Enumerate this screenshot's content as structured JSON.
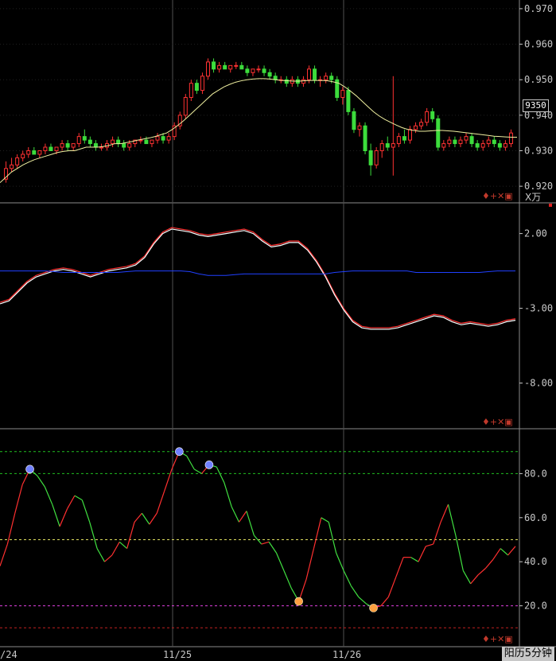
{
  "chart_data": [
    {
      "type": "candlestick",
      "panel": "price",
      "y_ticks": [
        "0.970",
        "0.960",
        "0.950",
        "0.940",
        "0.930",
        "0.920"
      ],
      "ylim": [
        0.916,
        0.972
      ],
      "current_price_label": "9350",
      "candles_ohlc": [
        [
          0.922,
          0.927,
          0.921,
          0.925
        ],
        [
          0.925,
          0.928,
          0.924,
          0.926
        ],
        [
          0.926,
          0.929,
          0.925,
          0.928
        ],
        [
          0.928,
          0.93,
          0.927,
          0.929
        ],
        [
          0.929,
          0.931,
          0.928,
          0.93
        ],
        [
          0.93,
          0.931,
          0.929,
          0.929
        ],
        [
          0.929,
          0.93,
          0.928,
          0.93
        ],
        [
          0.93,
          0.932,
          0.929,
          0.931
        ],
        [
          0.931,
          0.932,
          0.93,
          0.93
        ],
        [
          0.93,
          0.931,
          0.929,
          0.931
        ],
        [
          0.931,
          0.933,
          0.93,
          0.932
        ],
        [
          0.932,
          0.933,
          0.93,
          0.931
        ],
        [
          0.931,
          0.932,
          0.93,
          0.932
        ],
        [
          0.932,
          0.935,
          0.931,
          0.934
        ],
        [
          0.934,
          0.936,
          0.932,
          0.933
        ],
        [
          0.933,
          0.934,
          0.931,
          0.932
        ],
        [
          0.932,
          0.933,
          0.93,
          0.931
        ],
        [
          0.931,
          0.932,
          0.93,
          0.931
        ],
        [
          0.931,
          0.933,
          0.93,
          0.932
        ],
        [
          0.932,
          0.934,
          0.931,
          0.933
        ],
        [
          0.933,
          0.934,
          0.931,
          0.932
        ],
        [
          0.932,
          0.933,
          0.93,
          0.931
        ],
        [
          0.931,
          0.933,
          0.93,
          0.932
        ],
        [
          0.932,
          0.933,
          0.931,
          0.933
        ],
        [
          0.933,
          0.934,
          0.932,
          0.933
        ],
        [
          0.933,
          0.934,
          0.932,
          0.932
        ],
        [
          0.932,
          0.933,
          0.931,
          0.933
        ],
        [
          0.933,
          0.935,
          0.932,
          0.934
        ],
        [
          0.934,
          0.935,
          0.932,
          0.933
        ],
        [
          0.933,
          0.935,
          0.932,
          0.934
        ],
        [
          0.934,
          0.938,
          0.933,
          0.937
        ],
        [
          0.937,
          0.941,
          0.936,
          0.94
        ],
        [
          0.94,
          0.946,
          0.939,
          0.945
        ],
        [
          0.945,
          0.95,
          0.944,
          0.949
        ],
        [
          0.949,
          0.95,
          0.946,
          0.947
        ],
        [
          0.947,
          0.952,
          0.946,
          0.951
        ],
        [
          0.951,
          0.956,
          0.95,
          0.955
        ],
        [
          0.955,
          0.956,
          0.952,
          0.953
        ],
        [
          0.953,
          0.955,
          0.952,
          0.954
        ],
        [
          0.954,
          0.955,
          0.953,
          0.953
        ],
        [
          0.953,
          0.954,
          0.952,
          0.954
        ],
        [
          0.954,
          0.955,
          0.953,
          0.954
        ],
        [
          0.954,
          0.955,
          0.953,
          0.953
        ],
        [
          0.953,
          0.954,
          0.951,
          0.952
        ],
        [
          0.952,
          0.953,
          0.951,
          0.953
        ],
        [
          0.953,
          0.954,
          0.952,
          0.953
        ],
        [
          0.953,
          0.954,
          0.951,
          0.952
        ],
        [
          0.952,
          0.953,
          0.95,
          0.951
        ],
        [
          0.951,
          0.952,
          0.949,
          0.95
        ],
        [
          0.95,
          0.951,
          0.949,
          0.95
        ],
        [
          0.95,
          0.951,
          0.948,
          0.949
        ],
        [
          0.949,
          0.951,
          0.948,
          0.95
        ],
        [
          0.95,
          0.951,
          0.948,
          0.949
        ],
        [
          0.949,
          0.951,
          0.948,
          0.95
        ],
        [
          0.95,
          0.954,
          0.949,
          0.953
        ],
        [
          0.953,
          0.954,
          0.949,
          0.95
        ],
        [
          0.95,
          0.951,
          0.948,
          0.95
        ],
        [
          0.95,
          0.952,
          0.949,
          0.951
        ],
        [
          0.951,
          0.952,
          0.949,
          0.95
        ],
        [
          0.95,
          0.951,
          0.944,
          0.945
        ],
        [
          0.945,
          0.948,
          0.943,
          0.947
        ],
        [
          0.947,
          0.948,
          0.94,
          0.941
        ],
        [
          0.941,
          0.942,
          0.935,
          0.936
        ],
        [
          0.936,
          0.938,
          0.934,
          0.937
        ],
        [
          0.937,
          0.938,
          0.929,
          0.93
        ],
        [
          0.93,
          0.932,
          0.923,
          0.926
        ],
        [
          0.926,
          0.931,
          0.925,
          0.93
        ],
        [
          0.93,
          0.933,
          0.928,
          0.932
        ],
        [
          0.932,
          0.934,
          0.93,
          0.931
        ],
        [
          0.931,
          0.951,
          0.923,
          0.932
        ],
        [
          0.932,
          0.935,
          0.931,
          0.934
        ],
        [
          0.934,
          0.936,
          0.932,
          0.933
        ],
        [
          0.933,
          0.937,
          0.932,
          0.936
        ],
        [
          0.936,
          0.938,
          0.935,
          0.937
        ],
        [
          0.937,
          0.939,
          0.936,
          0.938
        ],
        [
          0.938,
          0.942,
          0.937,
          0.941
        ],
        [
          0.941,
          0.942,
          0.938,
          0.939
        ],
        [
          0.939,
          0.94,
          0.93,
          0.931
        ],
        [
          0.931,
          0.933,
          0.93,
          0.932
        ],
        [
          0.932,
          0.934,
          0.931,
          0.933
        ],
        [
          0.933,
          0.934,
          0.931,
          0.932
        ],
        [
          0.932,
          0.934,
          0.931,
          0.933
        ],
        [
          0.933,
          0.935,
          0.932,
          0.934
        ],
        [
          0.934,
          0.935,
          0.931,
          0.932
        ],
        [
          0.932,
          0.933,
          0.93,
          0.931
        ],
        [
          0.931,
          0.933,
          0.93,
          0.932
        ],
        [
          0.932,
          0.934,
          0.931,
          0.933
        ],
        [
          0.933,
          0.934,
          0.931,
          0.932
        ],
        [
          0.932,
          0.933,
          0.93,
          0.931
        ],
        [
          0.931,
          0.933,
          0.93,
          0.932
        ],
        [
          0.932,
          0.936,
          0.931,
          0.935
        ]
      ],
      "moving_average": [
        0.921,
        0.9225,
        0.924,
        0.925,
        0.926,
        0.9268,
        0.9275,
        0.928,
        0.9285,
        0.929,
        0.9295,
        0.9298,
        0.93,
        0.93,
        0.9305,
        0.931,
        0.931,
        0.931,
        0.9312,
        0.9315,
        0.932,
        0.932,
        0.9323,
        0.9326,
        0.933,
        0.9333,
        0.9336,
        0.934,
        0.9345,
        0.935,
        0.936,
        0.9372,
        0.9385,
        0.94,
        0.9415,
        0.943,
        0.9445,
        0.946,
        0.947,
        0.948,
        0.9487,
        0.9493,
        0.9497,
        0.95,
        0.9502,
        0.9503,
        0.9503,
        0.9502,
        0.95,
        0.9498,
        0.9497,
        0.9496,
        0.9496,
        0.9497,
        0.9498,
        0.9498,
        0.9498,
        0.9497,
        0.9494,
        0.949,
        0.948,
        0.9468,
        0.9455,
        0.944,
        0.9425,
        0.941,
        0.9398,
        0.9388,
        0.938,
        0.9372,
        0.9365,
        0.936,
        0.9357,
        0.9355,
        0.9355,
        0.9356,
        0.9357,
        0.9357,
        0.9356,
        0.9355,
        0.9353,
        0.9351,
        0.9349,
        0.9347,
        0.9345,
        0.9343,
        0.9341,
        0.934,
        0.9339,
        0.9338,
        0.9338
      ]
    },
    {
      "type": "line",
      "panel": "indicator-2",
      "unit_label": "X万",
      "y_ticks": [
        "2.00",
        "-3.00",
        "-8.00"
      ],
      "ylim": [
        -11,
        4
      ],
      "series": [
        {
          "color": "#ff3030",
          "values": [
            -2.6,
            -2.4,
            -1.8,
            -1.2,
            -0.8,
            -0.6,
            -0.4,
            -0.3,
            -0.4,
            -0.6,
            -0.8,
            -0.6,
            -0.4,
            -0.3,
            -0.2,
            0.0,
            0.5,
            1.4,
            2.1,
            2.4,
            2.3,
            2.2,
            2.0,
            1.9,
            2.0,
            2.1,
            2.2,
            2.3,
            2.1,
            1.6,
            1.2,
            1.3,
            1.5,
            1.5,
            1.0,
            0.2,
            -0.8,
            -2.0,
            -3.0,
            -3.8,
            -4.2,
            -4.3,
            -4.3,
            -4.3,
            -4.2,
            -4.0,
            -3.8,
            -3.6,
            -3.4,
            -3.5,
            -3.8,
            -4.0,
            -3.9,
            -4.0,
            -4.1,
            -4.0,
            -3.8,
            -3.7
          ]
        },
        {
          "color": "#ffffff",
          "values": [
            -2.7,
            -2.5,
            -1.9,
            -1.3,
            -0.9,
            -0.7,
            -0.5,
            -0.4,
            -0.5,
            -0.7,
            -0.9,
            -0.7,
            -0.5,
            -0.4,
            -0.3,
            -0.1,
            0.4,
            1.3,
            2.0,
            2.3,
            2.2,
            2.1,
            1.9,
            1.8,
            1.9,
            2.0,
            2.1,
            2.2,
            2.0,
            1.5,
            1.1,
            1.2,
            1.4,
            1.4,
            0.9,
            0.1,
            -0.9,
            -2.1,
            -3.1,
            -3.9,
            -4.3,
            -4.4,
            -4.4,
            -4.4,
            -4.3,
            -4.1,
            -3.9,
            -3.7,
            -3.5,
            -3.6,
            -3.9,
            -4.1,
            -4.0,
            -4.1,
            -4.2,
            -4.1,
            -3.9,
            -3.8
          ]
        },
        {
          "color": "#2040ff",
          "values": [
            -0.5,
            -0.5,
            -0.5,
            -0.5,
            -0.5,
            -0.5,
            -0.55,
            -0.6,
            -0.6,
            -0.6,
            -0.6,
            -0.6,
            -0.6,
            -0.6,
            -0.55,
            -0.5,
            -0.5,
            -0.5,
            -0.5,
            -0.5,
            -0.5,
            -0.55,
            -0.7,
            -0.8,
            -0.8,
            -0.8,
            -0.75,
            -0.7,
            -0.7,
            -0.7,
            -0.7,
            -0.7,
            -0.7,
            -0.7,
            -0.7,
            -0.7,
            -0.7,
            -0.6,
            -0.55,
            -0.5,
            -0.5,
            -0.5,
            -0.5,
            -0.5,
            -0.5,
            -0.5,
            -0.6,
            -0.6,
            -0.6,
            -0.6,
            -0.6,
            -0.6,
            -0.6,
            -0.6,
            -0.55,
            -0.5,
            -0.5,
            -0.5
          ]
        }
      ]
    },
    {
      "type": "line",
      "panel": "oscillator",
      "y_ticks": [
        "80.0",
        "60.0",
        "40.0",
        "20.0"
      ],
      "ylim": [
        0,
        100
      ],
      "reference_lines": [
        {
          "value": 90,
          "color": "#20c020"
        },
        {
          "value": 80,
          "color": "#20c020"
        },
        {
          "value": 50,
          "color": "#e0e060"
        },
        {
          "value": 20,
          "color": "#e040e0"
        },
        {
          "value": 10,
          "color": "#c02020"
        }
      ],
      "values": [
        38,
        48,
        62,
        75,
        82,
        79,
        74,
        66,
        56,
        64,
        70,
        68,
        58,
        46,
        40,
        43,
        49,
        46,
        58,
        62,
        57,
        62,
        72,
        82,
        90,
        88,
        82,
        80,
        84,
        83,
        76,
        65,
        58,
        63,
        52,
        48,
        49,
        44,
        36,
        28,
        22,
        32,
        46,
        60,
        58,
        44,
        36,
        29,
        24,
        21,
        19,
        20,
        24,
        33,
        42,
        42,
        40,
        47,
        48,
        58,
        66,
        52,
        36,
        30,
        34,
        37,
        41,
        46,
        43,
        47
      ]
    }
  ],
  "x_axis": {
    "tick_labels": [
      "/24",
      "11/25",
      "11/26"
    ]
  },
  "toolbar_glyphs": "♦+✕▣",
  "footer_label": "阳历5分钟"
}
